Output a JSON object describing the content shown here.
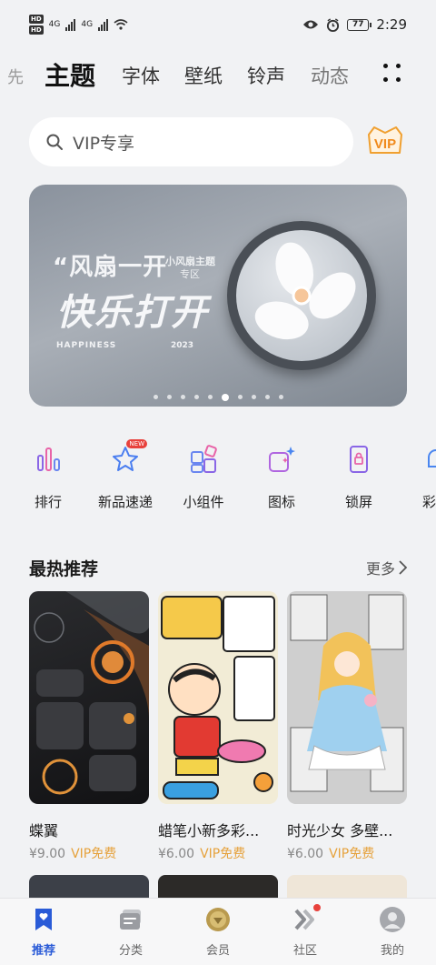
{
  "status_bar": {
    "hd1": "HD",
    "hd2": "HD",
    "net1": "4G",
    "net2": "4G",
    "battery": "77",
    "time": "2:29"
  },
  "tabs": [
    {
      "label": "先"
    },
    {
      "label": "主题"
    },
    {
      "label": "字体"
    },
    {
      "label": "壁纸"
    },
    {
      "label": "铃声"
    },
    {
      "label": "动态"
    }
  ],
  "search": {
    "placeholder": "VIP专享"
  },
  "vip_badge": "VIP",
  "banner": {
    "title": "“风扇一开",
    "tag1": "小风扇主题",
    "tag2": "专区",
    "headline": "快乐打开",
    "english": "HAPPINESS",
    "year": "2023",
    "page_count": 10,
    "active_page": 6
  },
  "categories": [
    {
      "label": "排行",
      "icon": "ranking-icon"
    },
    {
      "label": "新品速递",
      "icon": "new-star-icon",
      "badge": "NEW"
    },
    {
      "label": "小组件",
      "icon": "widget-icon"
    },
    {
      "label": "图标",
      "icon": "icons-icon"
    },
    {
      "label": "锁屏",
      "icon": "lockscreen-icon"
    },
    {
      "label": "彩",
      "icon": "bell-icon"
    }
  ],
  "hot": {
    "title": "最热推荐",
    "more": "更多",
    "items": [
      {
        "name": "蝶翼",
        "price": "¥9.00",
        "vip": "VIP免费"
      },
      {
        "name": "蜡笔小新多彩...",
        "price": "¥6.00",
        "vip": "VIP免费"
      },
      {
        "name": "时光少女 多壁...",
        "price": "¥6.00",
        "vip": "VIP免费"
      }
    ]
  },
  "bottom_nav": [
    {
      "label": "推荐",
      "active": true
    },
    {
      "label": "分类"
    },
    {
      "label": "会员"
    },
    {
      "label": "社区"
    },
    {
      "label": "我的"
    }
  ],
  "colors": {
    "accent": "#2a5bd7",
    "vip": "#e6a23c",
    "badge_red": "#e8413c"
  }
}
